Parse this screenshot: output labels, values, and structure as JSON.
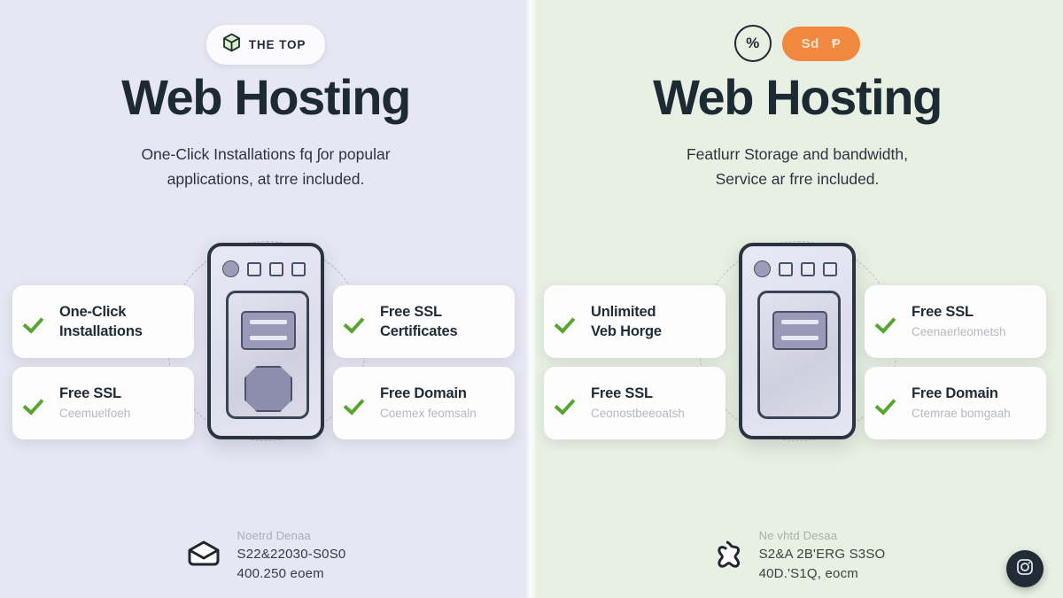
{
  "colors": {
    "left_bg": "#e7e7f3",
    "right_bg": "#e8f0e3",
    "heading": "#1c2b33",
    "check_green": "#55a52e",
    "orange_pill": "#f0883f",
    "card_bg": "#fdfdfd",
    "fab_dark": "#222c36"
  },
  "left_panel": {
    "badge": {
      "icon": "cube-icon",
      "label": "THE TOP"
    },
    "title": "Web Hosting",
    "subtitle_line1": "One-Click Installations fq ʃor popular",
    "subtitle_line2": "applications, at trre included.",
    "cards": [
      {
        "title_line1": "One-Click",
        "title_line2": "Installations",
        "subtitle": ""
      },
      {
        "title_line1": "Free SSL",
        "title_line2": "Certificates",
        "subtitle": ""
      },
      {
        "title_line1": "Free SSL",
        "title_line2": "",
        "subtitle": "Ceemuelfoeh"
      },
      {
        "title_line1": "Free Domain",
        "title_line2": "",
        "subtitle": "Coemex feomsaln"
      }
    ],
    "footer": {
      "icon": "mail-envelope-icon",
      "line1": "Noetrd Denaa",
      "line2": "S22&22030-S0S0",
      "line3": "400.250 eoem"
    }
  },
  "right_panel": {
    "badge_circle": {
      "icon": "percent-circle-icon",
      "label": "%"
    },
    "badge_pill": {
      "label": "Sd",
      "icon": "currency-glyph-icon",
      "glyph": "Ᵽ"
    },
    "title": "Web Hosting",
    "subtitle_line1": "Featlurr Storage and bandwidth,",
    "subtitle_line2": "Service ar frre included.",
    "cards": [
      {
        "title_line1": "Unlimited",
        "title_line2": "Veb Horge",
        "subtitle": ""
      },
      {
        "title_line1": "Free SSL",
        "title_line2": "",
        "subtitle": "Ceenaerleometsh"
      },
      {
        "title_line1": "Free SSL",
        "title_line2": "",
        "subtitle": "Ceonostbeeoatsh"
      },
      {
        "title_line1": "Free Domain",
        "title_line2": "",
        "subtitle": "Ctemrae bomgaah"
      }
    ],
    "footer": {
      "icon": "cross-star-icon",
      "line1": "Ne vhtd Desaa",
      "line2": "S2&A 2B'ERG S3SO",
      "line3": "40D.'S1Q, eocm"
    },
    "social_button": {
      "icon": "instagram-camera-icon"
    }
  }
}
